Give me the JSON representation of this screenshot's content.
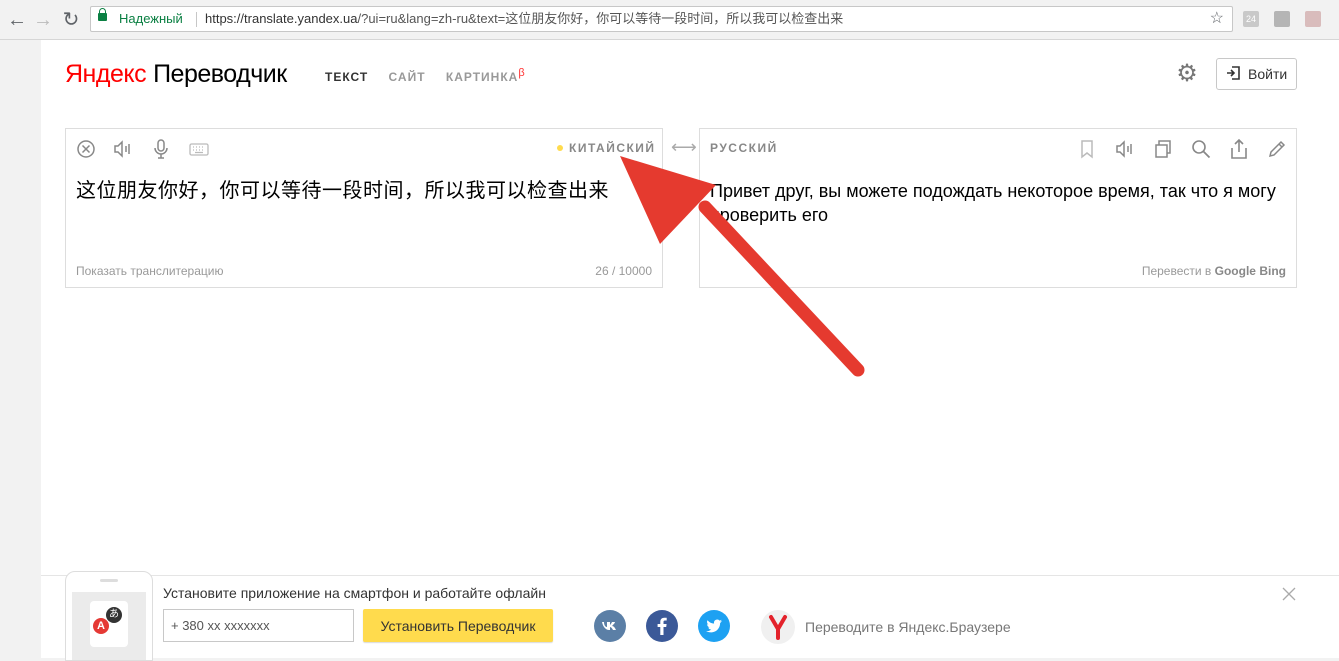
{
  "browser": {
    "secure_label": "Надежный",
    "url_host": "https://translate.yandex.ua",
    "url_rest": "/?ui=ru&lang=zh-ru&text=这位朋友你好，你可以等待一段时间，所以我可以检查出来",
    "ext_badge": "24"
  },
  "header": {
    "logo_brand": "Яндекс",
    "logo_product": "Переводчик",
    "tabs": [
      {
        "label": "ТЕКСТ",
        "active": true
      },
      {
        "label": "САЙТ",
        "active": false
      },
      {
        "label": "КАРТИНКА",
        "beta": "β",
        "active": false
      }
    ],
    "login_label": "Войти"
  },
  "source": {
    "language": "КИТАЙСКИЙ",
    "text": "这位朋友你好，你可以等待一段时间，所以我可以检查出来",
    "transliteration_link": "Показать транслитерацию",
    "char_count": "26 / 10000"
  },
  "target": {
    "language": "РУССКИЙ",
    "text": "Привет друг, вы можете подождать некоторое время, так что я могу проверить его",
    "translate_in": "Перевести в",
    "engine_google": "Google",
    "engine_bing": "Bing"
  },
  "promo": {
    "title": "Установите приложение на смартфон и работайте офлайн",
    "phone_placeholder": "+ 380 xx xxxxxxx",
    "install_button": "Установить Переводчик",
    "browser_text": "Переводите в Яндекс.Браузере"
  },
  "colors": {
    "accent_yellow": "#ffdb4d",
    "logo_red": "#ff0000",
    "annotation_arrow": "#e53a2f",
    "vk": "#5b7fa6",
    "facebook": "#3b5998",
    "twitter": "#1da1f2",
    "secure_green": "#0b8043"
  }
}
